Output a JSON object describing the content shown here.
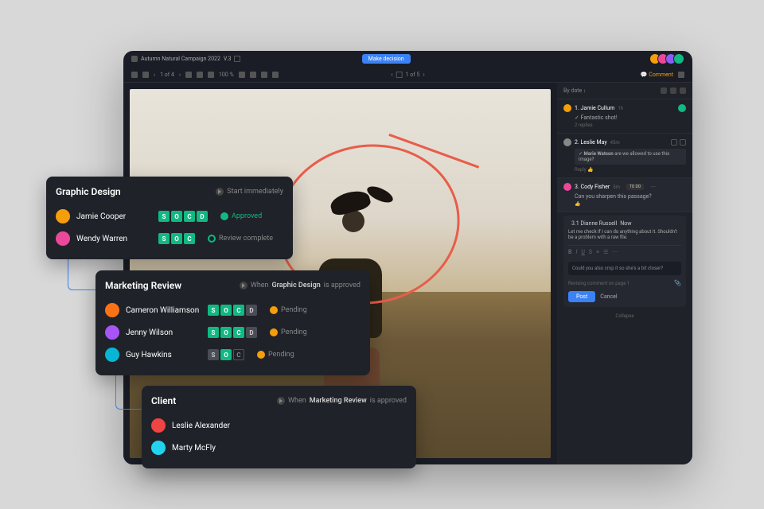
{
  "breadcrumb": {
    "title": "Autumn Natural Campaign 2022",
    "version": "V.3"
  },
  "topbar": {
    "decision_btn": "Make decision"
  },
  "toolbar": {
    "page_of_4": "1 of 4",
    "zoom": "100 %",
    "page_of_5": "1 of 5",
    "comment_btn": "Comment"
  },
  "sidebar": {
    "sort": "By date",
    "comments": [
      {
        "num": "1.",
        "author": "Jamie Cullum",
        "time": "1h",
        "text": "Fantastic shot!",
        "replies": "2 replies",
        "avatar": "#f59e0b"
      },
      {
        "num": "2.",
        "author": "Leslie May",
        "time": "45m",
        "highlight_author": "Marie Watson",
        "highlight": "are we allowed to use this image?",
        "reply_label": "Reply",
        "avatar": "#888"
      },
      {
        "num": "3.",
        "author": "Cody Fisher",
        "time": "5m",
        "text": "Can you sharpen this passage?",
        "todo": "TO DO",
        "avatar": "#ec4899"
      }
    ],
    "reply": {
      "num": "3.1",
      "author": "Dianne Russell",
      "time": "Now",
      "text": "Let me check if I can do anything about it. Shouldn't be a problem with a raw file.",
      "input": "Could you also crop it so she's a bit closer?",
      "page_note": "Revising comment on page 1",
      "post": "Post",
      "cancel": "Cancel"
    },
    "collapse": "Collapse"
  },
  "workflow": [
    {
      "title": "Graphic Design",
      "trigger": "Start immediately",
      "reviewers": [
        {
          "name": "Jamie Cooper",
          "badges": [
            "S",
            "O",
            "C",
            "D"
          ],
          "badge_active": [
            1,
            1,
            1,
            1
          ],
          "status": "Approved",
          "status_type": "approved",
          "avatar": "#f59e0b"
        },
        {
          "name": "Wendy Warren",
          "badges": [
            "S",
            "O",
            "C"
          ],
          "badge_active": [
            1,
            1,
            1
          ],
          "status": "Review complete",
          "status_type": "complete",
          "avatar": "#ec4899"
        }
      ]
    },
    {
      "title": "Marketing Review",
      "trigger_prefix": "When ",
      "trigger_bold": "Graphic Design",
      "trigger_suffix": " is approved",
      "reviewers": [
        {
          "name": "Cameron Williamson",
          "badges": [
            "S",
            "O",
            "C",
            "D"
          ],
          "badge_active": [
            1,
            1,
            1,
            0
          ],
          "status": "Pending",
          "status_type": "pending",
          "avatar": "#f97316"
        },
        {
          "name": "Jenny Wilson",
          "badges": [
            "S",
            "O",
            "C",
            "D"
          ],
          "badge_active": [
            1,
            1,
            1,
            0
          ],
          "status": "Pending",
          "status_type": "pending",
          "avatar": "#a855f7"
        },
        {
          "name": "Guy Hawkins",
          "badges": [
            "S",
            "O",
            "C"
          ],
          "badge_active": [
            0,
            1,
            0
          ],
          "status": "Pending",
          "status_type": "pending",
          "avatar": "#06b6d4"
        }
      ]
    },
    {
      "title": "Client",
      "trigger_prefix": "When ",
      "trigger_bold": "Marketing Review",
      "trigger_suffix": " is approved",
      "reviewers": [
        {
          "name": "Leslie Alexander",
          "avatar": "#ef4444"
        },
        {
          "name": "Marty McFly",
          "avatar": "#22d3ee"
        }
      ]
    }
  ]
}
